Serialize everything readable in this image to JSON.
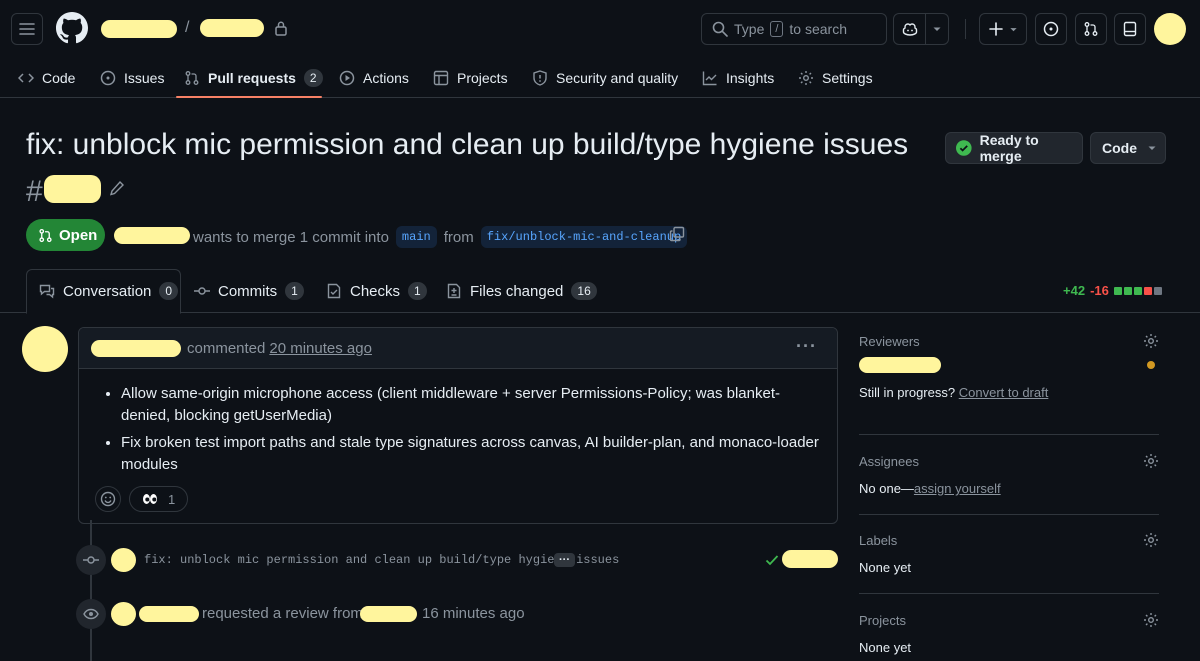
{
  "header": {
    "search_prefix": "Type",
    "search_key": "/",
    "search_suffix": "to search"
  },
  "repo_nav": [
    {
      "label": "Code"
    },
    {
      "label": "Issues"
    },
    {
      "label": "Pull requests",
      "count": "2"
    },
    {
      "label": "Actions"
    },
    {
      "label": "Projects"
    },
    {
      "label": "Security and quality"
    },
    {
      "label": "Insights"
    },
    {
      "label": "Settings"
    }
  ],
  "pr": {
    "title": "fix: unblock mic permission and clean up build/type hygiene issues",
    "number_prefix": "#",
    "ready_label": "Ready to merge",
    "code_label": "Code",
    "state": "Open",
    "merge_text": "wants to merge 1 commit into",
    "base_branch": "main",
    "from_text": "from",
    "head_branch": "fix/unblock-mic-and-cleanup"
  },
  "tabs": [
    {
      "label": "Conversation",
      "count": "0"
    },
    {
      "label": "Commits",
      "count": "1"
    },
    {
      "label": "Checks",
      "count": "1"
    },
    {
      "label": "Files changed",
      "count": "16"
    }
  ],
  "diffstat": {
    "additions": "+42",
    "deletions": "-16",
    "blocks": [
      "#3fb950",
      "#3fb950",
      "#3fb950",
      "#f85149",
      "#6e7681"
    ]
  },
  "comment": {
    "action": "commented",
    "time": "20 minutes ago",
    "bullets": [
      "Allow same-origin microphone access (client middleware + server Permissions-Policy; was blanket-denied, blocking getUserMedia)",
      "Fix broken test import paths and stale type signatures across canvas, AI builder-plan, and monaco-loader modules"
    ],
    "reaction_count": "1"
  },
  "timeline": {
    "commit_message": "fix: unblock mic permission and clean up build/type hygiene issues",
    "commit_more": "···",
    "review_text": "requested a review from",
    "review_time": "16 minutes ago"
  },
  "sidebar": {
    "reviewers_label": "Reviewers",
    "draft_prefix": "Still in progress?",
    "draft_link": "Convert to draft",
    "assignees_label": "Assignees",
    "assignees_prefix": "No one—",
    "assignees_link": "assign yourself",
    "labels_label": "Labels",
    "labels_value": "None yet",
    "projects_label": "Projects",
    "projects_value": "None yet"
  },
  "colors": {
    "accent_green": "#238636",
    "link_blue": "#58a6ff",
    "tab_underline": "#f78166",
    "pending_dot": "#d29922"
  }
}
